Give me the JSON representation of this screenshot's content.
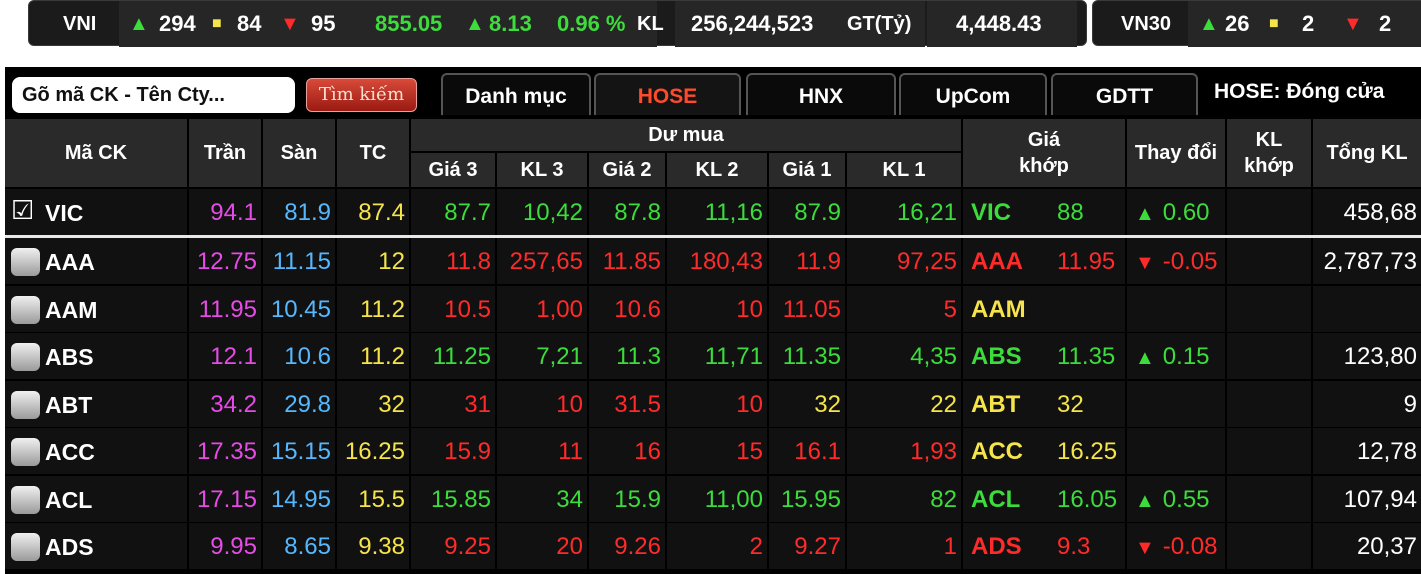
{
  "index_bar": {
    "vni": {
      "label": "VNI",
      "up_count": "294",
      "ref_count": "84",
      "down_count": "95",
      "value": "855.05",
      "change": "8.13",
      "percent": "0.96 %",
      "kl_label": "KL",
      "kl_value": "256,244,523",
      "gt_label": "GT(Tỷ)",
      "gt_value": "4,448.43"
    },
    "vn30": {
      "label": "VN30",
      "up_count": "26",
      "ref_count": "2",
      "down_count": "2"
    }
  },
  "toolbar": {
    "search_value": "Gõ mã CK - Tên Cty...",
    "search_button": "Tìm kiếm",
    "tabs": [
      {
        "label": "Danh mục"
      },
      {
        "label": "HOSE"
      },
      {
        "label": "HNX"
      },
      {
        "label": "UpCom"
      },
      {
        "label": "GDTT"
      }
    ],
    "active_tab": "HOSE",
    "status": "HOSE:  Đóng cửa"
  },
  "table": {
    "headers": {
      "symbol": "Mã CK",
      "ceiling": "Trần",
      "floor": "Sàn",
      "reference": "TC",
      "bid_group": "Dư mua",
      "price3": "Giá 3",
      "vol3": "KL 3",
      "price2": "Giá 2",
      "vol2": "KL 2",
      "price1": "Giá 1",
      "vol1": "KL 1",
      "match_price": "Giá\nkhớp",
      "change": "Thay đổi",
      "match_vol": "KL\nkhớp",
      "total_vol": "Tổng KL"
    },
    "pinned_row": {
      "symbol": "VIC",
      "checked": true,
      "ceiling": "94.1",
      "floor": "81.9",
      "ref": "87.4",
      "p3": "87.7",
      "v3": "10,42",
      "p2": "87.8",
      "v2": "11,16",
      "p1": "87.9",
      "v1": "16,21",
      "bid_color": "up",
      "msym": "VIC",
      "match": "88",
      "dir": "up",
      "chg": "0.60",
      "kl": "",
      "total": "458,68"
    },
    "rows": [
      {
        "symbol": "AAA",
        "ceiling": "12.75",
        "floor": "11.15",
        "ref": "12",
        "p3": "11.8",
        "v3": "257,65",
        "p2": "11.85",
        "v2": "180,43",
        "p1": "11.9",
        "v1": "97,25",
        "bid_color": "down",
        "msym": "AAA",
        "match": "11.95",
        "dir": "down",
        "chg": "-0.05",
        "kl": "",
        "total": "2,787,73"
      },
      {
        "symbol": "AAM",
        "ceiling": "11.95",
        "floor": "10.45",
        "ref": "11.2",
        "p3": "10.5",
        "v3": "1,00",
        "p2": "10.6",
        "v2": "10",
        "p1": "11.05",
        "v1": "5",
        "bid_color": "down",
        "msym": "AAM",
        "match": "",
        "dir": "ref",
        "chg": "",
        "kl": "",
        "total": ""
      },
      {
        "symbol": "ABS",
        "ceiling": "12.1",
        "floor": "10.6",
        "ref": "11.2",
        "p3": "11.25",
        "v3": "7,21",
        "p2": "11.3",
        "v2": "11,71",
        "p1": "11.35",
        "v1": "4,35",
        "bid_color": "up",
        "msym": "ABS",
        "match": "11.35",
        "dir": "up",
        "chg": "0.15",
        "kl": "",
        "total": "123,80"
      },
      {
        "symbol": "ABT",
        "ceiling": "34.2",
        "floor": "29.8",
        "ref": "32",
        "p3": "31",
        "v3": "10",
        "p2": "31.5",
        "v2": "10",
        "p1": "32",
        "v1": "22",
        "bid_color": "mixed",
        "msym": "ABT",
        "match": "32",
        "dir": "ref",
        "chg": "",
        "kl": "",
        "total": "9"
      },
      {
        "symbol": "ACC",
        "ceiling": "17.35",
        "floor": "15.15",
        "ref": "16.25",
        "p3": "15.9",
        "v3": "11",
        "p2": "16",
        "v2": "15",
        "p1": "16.1",
        "v1": "1,93",
        "bid_color": "down",
        "msym": "ACC",
        "match": "16.25",
        "dir": "ref",
        "chg": "",
        "kl": "",
        "total": "12,78"
      },
      {
        "symbol": "ACL",
        "ceiling": "17.15",
        "floor": "14.95",
        "ref": "15.5",
        "p3": "15.85",
        "v3": "34",
        "p2": "15.9",
        "v2": "11,00",
        "p1": "15.95",
        "v1": "82",
        "bid_color": "up",
        "msym": "ACL",
        "match": "16.05",
        "dir": "up",
        "chg": "0.55",
        "kl": "",
        "total": "107,94"
      },
      {
        "symbol": "ADS",
        "ceiling": "9.95",
        "floor": "8.65",
        "ref": "9.38",
        "p3": "9.25",
        "v3": "20",
        "p2": "9.26",
        "v2": "2",
        "p1": "9.27",
        "v1": "1",
        "bid_color": "down",
        "msym": "ADS",
        "match": "9.3",
        "dir": "down",
        "chg": "-0.08",
        "kl": "",
        "total": "20,37"
      }
    ]
  },
  "colors": {
    "up": "#3cdc3c",
    "ref": "#f5e44a",
    "down": "#ff2a2a",
    "ceiling": "#e74be7",
    "floor": "#55b8ff",
    "active_tab": "#ff4b2b"
  },
  "icons": {
    "up": "triangle-up-icon",
    "down": "triangle-down-icon",
    "ref": "square-icon",
    "check": "checkbox-icon"
  }
}
